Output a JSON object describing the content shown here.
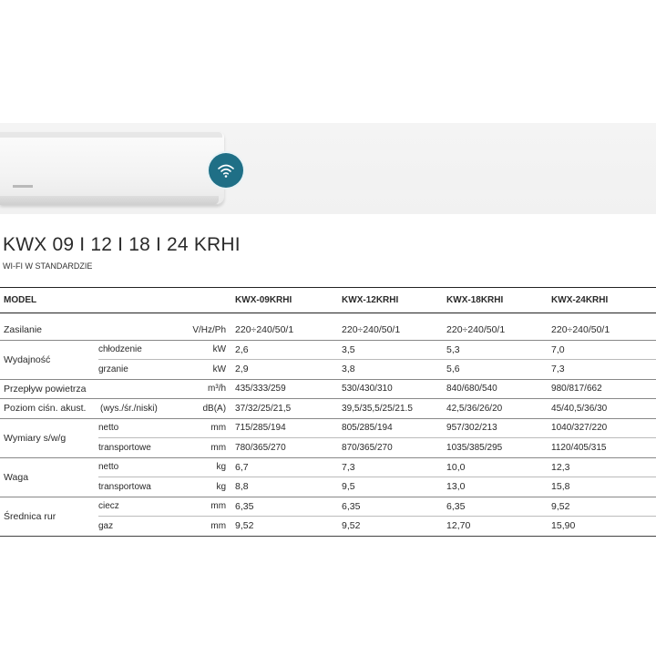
{
  "product": {
    "title": "KWX 09 I 12 I 18 I 24 KRHI",
    "subtitle": "WI-FI W STANDARDZIE",
    "icons": [
      "wifi-icon"
    ],
    "colors": {
      "wifi_badge": "#1f6f86"
    }
  },
  "table": {
    "header": {
      "model_label": "MODEL",
      "models": [
        "KWX-09KRHI",
        "KWX-12KRHI",
        "KWX-18KRHI",
        "KWX-24KRHI"
      ]
    },
    "zasilanie": {
      "label": "Zasilanie",
      "unit": "V/Hz/Ph",
      "values": [
        "220÷240/50/1",
        "220÷240/50/1",
        "220÷240/50/1",
        "220÷240/50/1"
      ]
    },
    "wydajnosc": {
      "label": "Wydajność",
      "chlodzenie": {
        "label": "chłodzenie",
        "unit": "kW",
        "values": [
          "2,6",
          "3,5",
          "5,3",
          "7,0"
        ]
      },
      "grzanie": {
        "label": "grzanie",
        "unit": "kW",
        "values": [
          "2,9",
          "3,8",
          "5,6",
          "7,3"
        ]
      }
    },
    "przeplyw": {
      "label": "Przepływ powietrza",
      "unit": "m³/h",
      "values": [
        "435/333/259",
        "530/430/310",
        "840/680/540",
        "980/817/662"
      ]
    },
    "poziom": {
      "label": "Poziom ciśn. akust.",
      "sub": "(wys./śr./niski)",
      "unit": "dB(A)",
      "values": [
        "37/32/25/21,5",
        "39,5/35,5/25/21.5",
        "42,5/36/26/20",
        "45/40,5/36/30"
      ]
    },
    "wymiary": {
      "label": "Wymiary s/w/g",
      "netto": {
        "label": "netto",
        "unit": "mm",
        "values": [
          "715/285/194",
          "805/285/194",
          "957/302/213",
          "1040/327/220"
        ]
      },
      "transportowe": {
        "label": "transportowe",
        "unit": "mm",
        "values": [
          "780/365/270",
          "870/365/270",
          "1035/385/295",
          "1120/405/315"
        ]
      }
    },
    "waga": {
      "label": "Waga",
      "netto": {
        "label": "netto",
        "unit": "kg",
        "values": [
          "6,7",
          "7,3",
          "10,0",
          "12,3"
        ]
      },
      "transportowa": {
        "label": "transportowa",
        "unit": "kg",
        "values": [
          "8,8",
          "9,5",
          "13,0",
          "15,8"
        ]
      }
    },
    "srednica": {
      "label": "Średnica rur",
      "ciecz": {
        "label": "ciecz",
        "unit": "mm",
        "values": [
          "6,35",
          "6,35",
          "6,35",
          "9,52"
        ]
      },
      "gaz": {
        "label": "gaz",
        "unit": "mm",
        "values": [
          "9,52",
          "9,52",
          "12,70",
          "15,90"
        ]
      }
    }
  }
}
